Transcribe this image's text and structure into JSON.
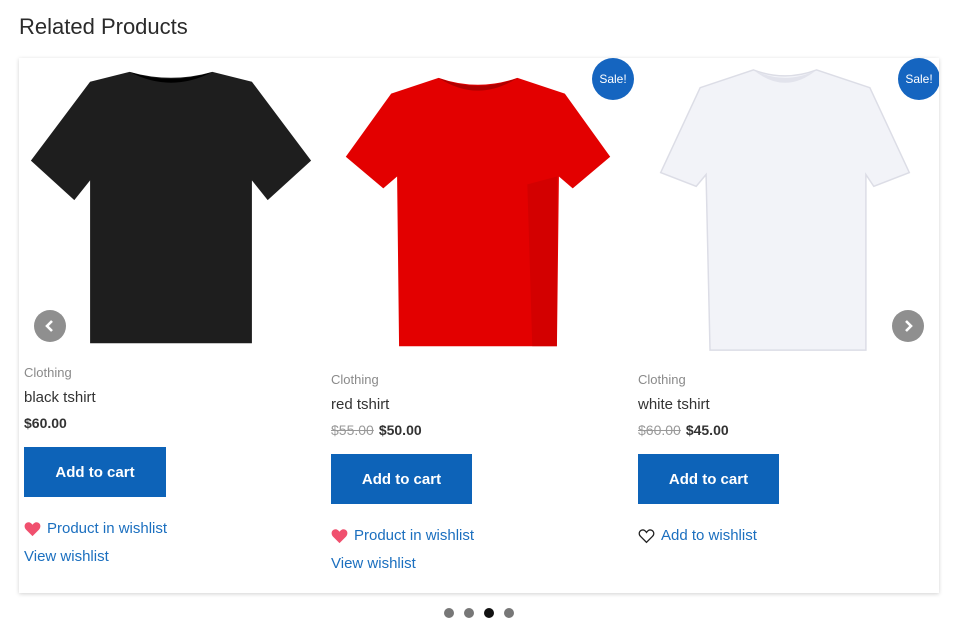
{
  "section": {
    "title": "Related Products"
  },
  "products": [
    {
      "name": "black tshirt",
      "category": "Clothing",
      "price": "$60.00",
      "old_price": "",
      "on_sale": false,
      "shirt_color": "#1e1e1e",
      "add_to_cart_label": "Add to cart",
      "wishlist_label": "Product in wishlist",
      "wishlist_icon": "heart-filled-icon",
      "view_wishlist_label": "View wishlist"
    },
    {
      "name": "red tshirt",
      "category": "Clothing",
      "price": "$50.00",
      "old_price": "$55.00",
      "on_sale": true,
      "sale_label": "Sale!",
      "shirt_color": "#e30000",
      "add_to_cart_label": "Add to cart",
      "wishlist_label": "Product in wishlist",
      "wishlist_icon": "heart-filled-icon",
      "view_wishlist_label": "View wishlist"
    },
    {
      "name": "white tshirt",
      "category": "Clothing",
      "price": "$45.00",
      "old_price": "$60.00",
      "on_sale": true,
      "sale_label": "Sale!",
      "shirt_color": "#f2f3f8",
      "add_to_cart_label": "Add to cart",
      "wishlist_label": "Add to wishlist",
      "wishlist_icon": "heart-outline-icon"
    }
  ],
  "carousel": {
    "prev_icon": "chevron-left-icon",
    "next_icon": "chevron-right-icon",
    "page_count": 4,
    "active_page": 3
  },
  "colors": {
    "button": "#0d63b8",
    "link": "#1b6fbf",
    "sale_badge": "#1565c0",
    "heart": "#f0506e"
  }
}
